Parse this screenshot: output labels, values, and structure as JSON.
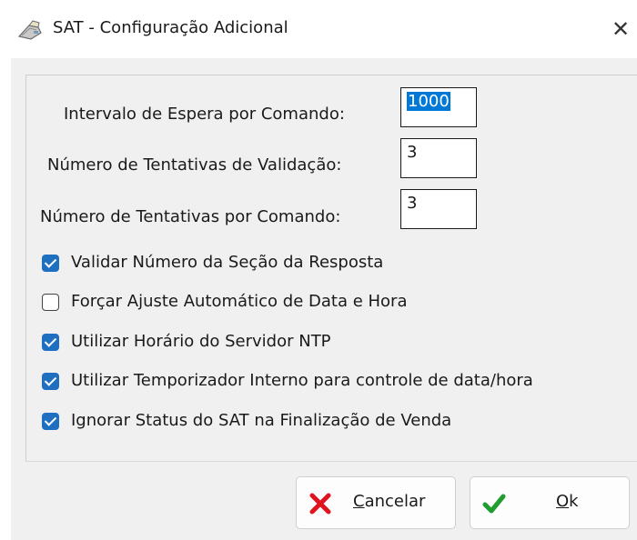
{
  "window": {
    "title": "SAT - Configuração Adicional",
    "close_symbol": "✕"
  },
  "fields": [
    {
      "label": "Intervalo de Espera por Comando:",
      "value": "1000",
      "selected": true
    },
    {
      "label": "Número de Tentativas de Validação:",
      "value": "3",
      "selected": false
    },
    {
      "label": "Número de Tentativas por Comando:",
      "value": "3",
      "selected": false
    }
  ],
  "checkboxes": [
    {
      "label": "Validar Número da Seção da Resposta",
      "checked": true
    },
    {
      "label": "Forçar Ajuste Automático de Data e Hora",
      "checked": false
    },
    {
      "label": "Utilizar Horário do Servidor NTP",
      "checked": true
    },
    {
      "label": "Utilizar Temporizador Interno para controle de data/hora",
      "checked": true
    },
    {
      "label": "Ignorar Status do SAT na Finalização de Venda",
      "checked": true
    }
  ],
  "buttons": {
    "cancel": {
      "mnemonic": "C",
      "rest": "ancelar",
      "icon": "x-cross-icon",
      "icon_color": "#e0141e"
    },
    "ok": {
      "mnemonic": "O",
      "rest": "k",
      "icon": "checkmark-icon",
      "icon_color": "#1f9d2f"
    }
  },
  "colors": {
    "checkbox_checked": "#1f6fc1",
    "selection_highlight": "#0078d7"
  }
}
